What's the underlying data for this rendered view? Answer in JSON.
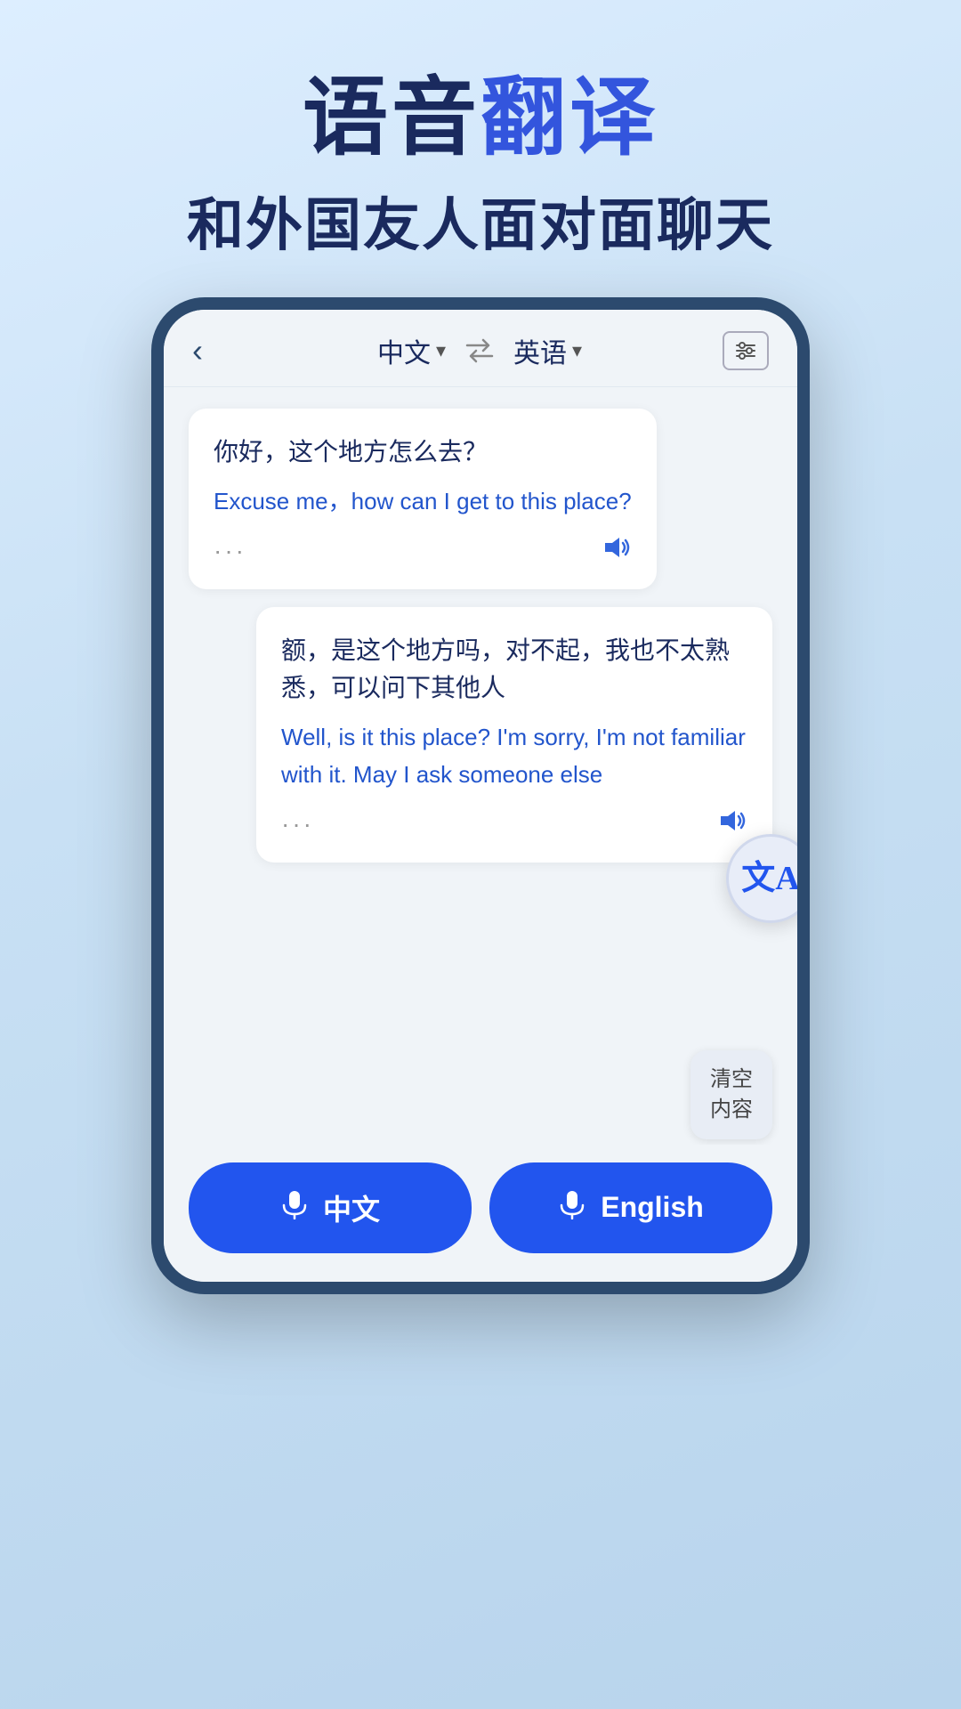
{
  "header": {
    "title_part1": "语音",
    "title_part2": "翻译",
    "subtitle": "和外国友人面对面聊天"
  },
  "phone": {
    "topbar": {
      "back_label": "‹",
      "lang_left": "中文",
      "lang_right": "英语",
      "swap_label": "⇄",
      "settings_label": "⊞"
    },
    "messages": [
      {
        "id": "msg1",
        "side": "left",
        "original": "你好，这个地方怎么去？",
        "translated": "Excuse me，how can I get to this place?",
        "dots": "···"
      },
      {
        "id": "msg2",
        "side": "right",
        "original": "额，是这个地方吗，对不起，我也不太熟悉，可以问下其他人",
        "translated": "Well, is it this place? I'm sorry, I'm not familiar with it. May I ask someone else",
        "dots": "···"
      }
    ],
    "clear_btn": {
      "line1": "清空",
      "line2": "内容"
    },
    "bottom_buttons": [
      {
        "id": "btn_chinese",
        "label": "中文",
        "mic_symbol": "🎤"
      },
      {
        "id": "btn_english",
        "label": "English",
        "mic_symbol": "🎤"
      }
    ]
  }
}
